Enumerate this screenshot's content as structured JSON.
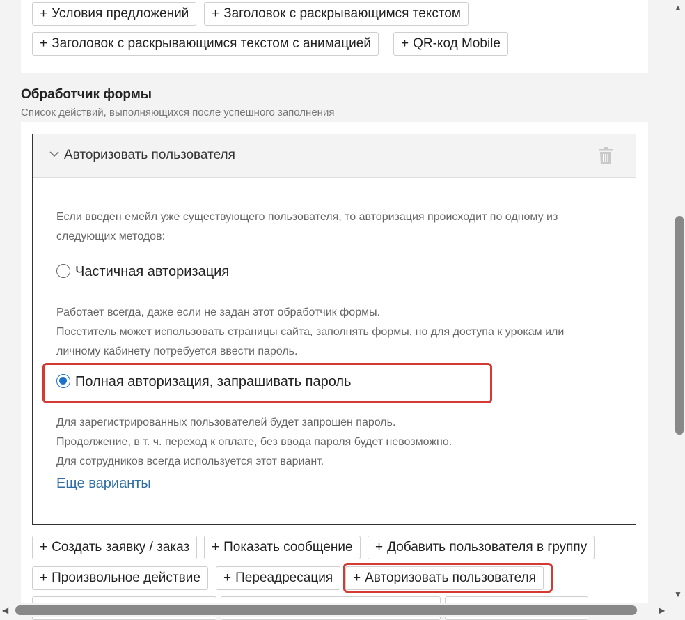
{
  "top_chips": [
    {
      "label": "Условия предложений"
    },
    {
      "label": "Заголовок с раскрывающимся текстом"
    },
    {
      "label": "Заголовок с раскрывающимся текстом с анимацией"
    },
    {
      "label": "QR-код Mobile"
    }
  ],
  "plus": "+",
  "form_handler": {
    "title": "Обработчик формы",
    "subtitle": "Список действий, выполняющихся после успешного заполнения"
  },
  "card": {
    "title": "Авторизовать пользователя",
    "intro_line1": "Если введен емейл уже существующего пользователя, то авторизация происходит по одному из",
    "intro_line2": "следующих методов:",
    "option1": {
      "label": "Частичная авторизация",
      "selected": false,
      "desc_line1": "Работает всегда, даже если не задан этот обработчик формы.",
      "desc_line2": "Посетитель может использовать страницы сайта, заполнять формы, но для доступа к урокам или",
      "desc_line3": "личному кабинету потребуется ввести пароль."
    },
    "option2": {
      "label": "Полная авторизация, запрашивать пароль",
      "selected": true,
      "desc_line1": "Для зарегистрированных пользователей будет запрошен пароль.",
      "desc_line2": "Продолжение, в т. ч. переход к оплате, без ввода пароля будет невозможно.",
      "desc_line3": "Для сотрудников всегда используется этот вариант."
    },
    "more_link": "Еще варианты"
  },
  "action_chips": [
    {
      "label": "Создать заявку / заказ"
    },
    {
      "label": "Показать сообщение"
    },
    {
      "label": "Добавить пользователя в группу"
    },
    {
      "label": "Произвольное действие"
    },
    {
      "label": "Переадресация"
    },
    {
      "label": "Авторизовать пользователя"
    }
  ],
  "colors": {
    "highlight": "#d23a33",
    "link": "#2f6fa5",
    "radio_selected": "#1a73c8"
  },
  "icons": {
    "collapse": "chevron-down-icon",
    "delete": "trash-icon"
  }
}
